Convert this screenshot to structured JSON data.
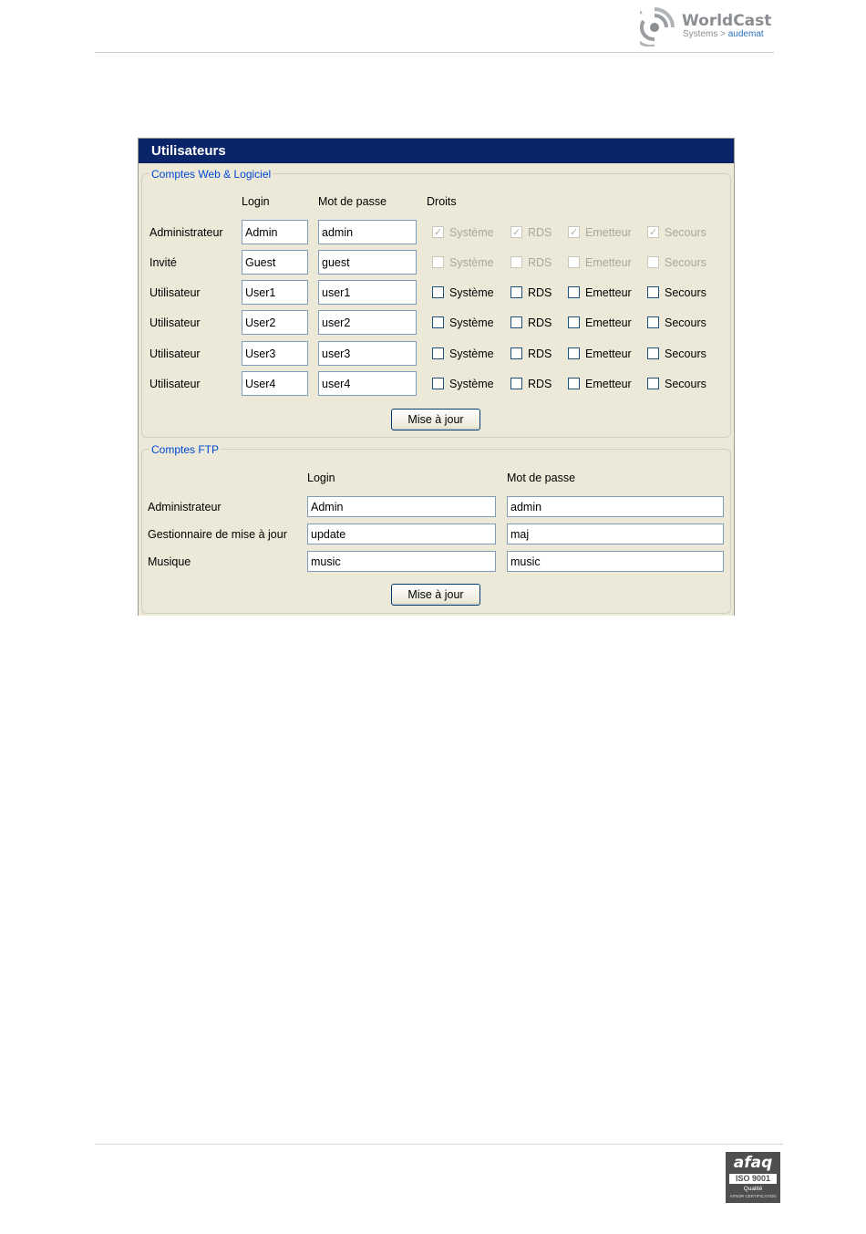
{
  "header": {
    "brand_name": "WorldCast",
    "brand_sub_left": "Systems",
    "brand_sub_sep": ">",
    "brand_sub_right": "audemat"
  },
  "footer": {
    "cert_word": "afaq",
    "cert_iso": "ISO 9001",
    "cert_quality": "Qualité",
    "cert_sub": "AFNOR CERTIFICATION"
  },
  "window": {
    "title": "Utilisateurs",
    "web_group": {
      "legend": "Comptes Web & Logiciel",
      "headers": {
        "login": "Login",
        "password": "Mot de passe",
        "rights": "Droits"
      },
      "rights_labels": [
        "Système",
        "RDS",
        "Emetteur",
        "Secours"
      ],
      "rows": [
        {
          "label": "Administrateur",
          "login": "Admin",
          "password": "admin",
          "rights": [
            true,
            true,
            true,
            true
          ],
          "disabled": true
        },
        {
          "label": "Invité",
          "login": "Guest",
          "password": "guest",
          "rights": [
            false,
            false,
            false,
            false
          ],
          "disabled": true
        },
        {
          "label": "Utilisateur",
          "login": "User1",
          "password": "user1",
          "rights": [
            false,
            false,
            false,
            false
          ],
          "disabled": false
        },
        {
          "label": "Utilisateur",
          "login": "User2",
          "password": "user2",
          "rights": [
            false,
            false,
            false,
            false
          ],
          "disabled": false
        },
        {
          "label": "Utilisateur",
          "login": "User3",
          "password": "user3",
          "rights": [
            false,
            false,
            false,
            false
          ],
          "disabled": false
        },
        {
          "label": "Utilisateur",
          "login": "User4",
          "password": "user4",
          "rights": [
            false,
            false,
            false,
            false
          ],
          "disabled": false
        }
      ],
      "update_button": "Mise à jour"
    },
    "ftp_group": {
      "legend": "Comptes FTP",
      "headers": {
        "login": "Login",
        "password": "Mot de passe"
      },
      "rows": [
        {
          "label": "Administrateur",
          "login": "Admin",
          "password": "admin"
        },
        {
          "label": "Gestionnaire de mise à jour",
          "login": "update",
          "password": "maj"
        },
        {
          "label": "Musique",
          "login": "music",
          "password": "music"
        }
      ],
      "update_button": "Mise à jour"
    }
  }
}
